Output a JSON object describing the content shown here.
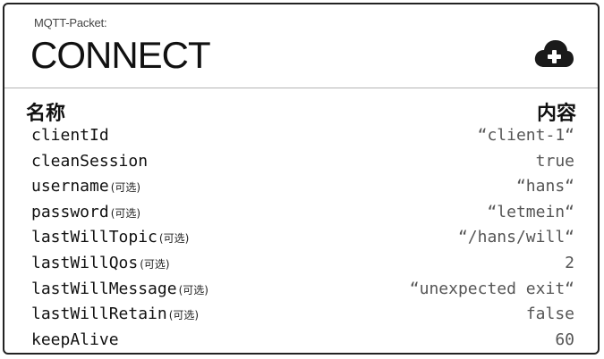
{
  "header": {
    "subtitle": "MQTT-Packet:",
    "title": "CONNECT",
    "icon": "cloud-upload-icon"
  },
  "columns": {
    "name": "名称",
    "content": "内容"
  },
  "optional_tag": "(可选)",
  "rows": [
    {
      "field": "clientId",
      "optional": "",
      "value": "“client-1“"
    },
    {
      "field": "cleanSession",
      "optional": "",
      "value": "true"
    },
    {
      "field": "username",
      "optional": "(可选)",
      "value": "“hans“"
    },
    {
      "field": "password",
      "optional": "(可选)",
      "value": "“letmein“"
    },
    {
      "field": "lastWillTopic",
      "optional": "(可选)",
      "value": "“/hans/will“"
    },
    {
      "field": "lastWillQos",
      "optional": "(可选)",
      "value": "2"
    },
    {
      "field": "lastWillMessage",
      "optional": "(可选)",
      "value": "“unexpected exit“"
    },
    {
      "field": "lastWillRetain",
      "optional": "(可选)",
      "value": "false"
    },
    {
      "field": "keepAlive",
      "optional": "",
      "value": "60"
    }
  ]
}
